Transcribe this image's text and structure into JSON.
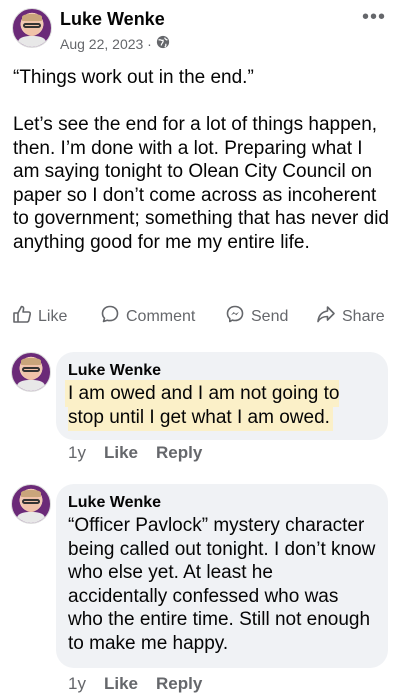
{
  "post": {
    "author": "Luke Wenke",
    "date": "Aug 22, 2023 ·",
    "paragraphs": [
      "“Things work out in the end.”",
      "Let’s see the end for a lot of things happen, then.  I’m done with a lot. Preparing what I am saying tonight to Olean City Council on paper so I don’t come across as incoherent to government; something that has never did anything good for me my entire life."
    ]
  },
  "actions": {
    "like": "Like",
    "comment": "Comment",
    "send": "Send",
    "share": "Share"
  },
  "comments": [
    {
      "author": "Luke Wenke",
      "text": "I am owed and I am not going to stop until I get what I am owed.",
      "age": "1y",
      "like": "Like",
      "reply": "Reply"
    },
    {
      "author": "Luke Wenke",
      "text": "“Officer Pavlock” mystery character being called out tonight.  I don’t know who else yet.  At least he accidentally confessed who was who the entire time.  Still not enough to make me happy.",
      "age": "1y",
      "like": "Like",
      "reply": "Reply"
    }
  ],
  "icons": {
    "more": "more-options-icon",
    "privacy": "globe-icon"
  }
}
